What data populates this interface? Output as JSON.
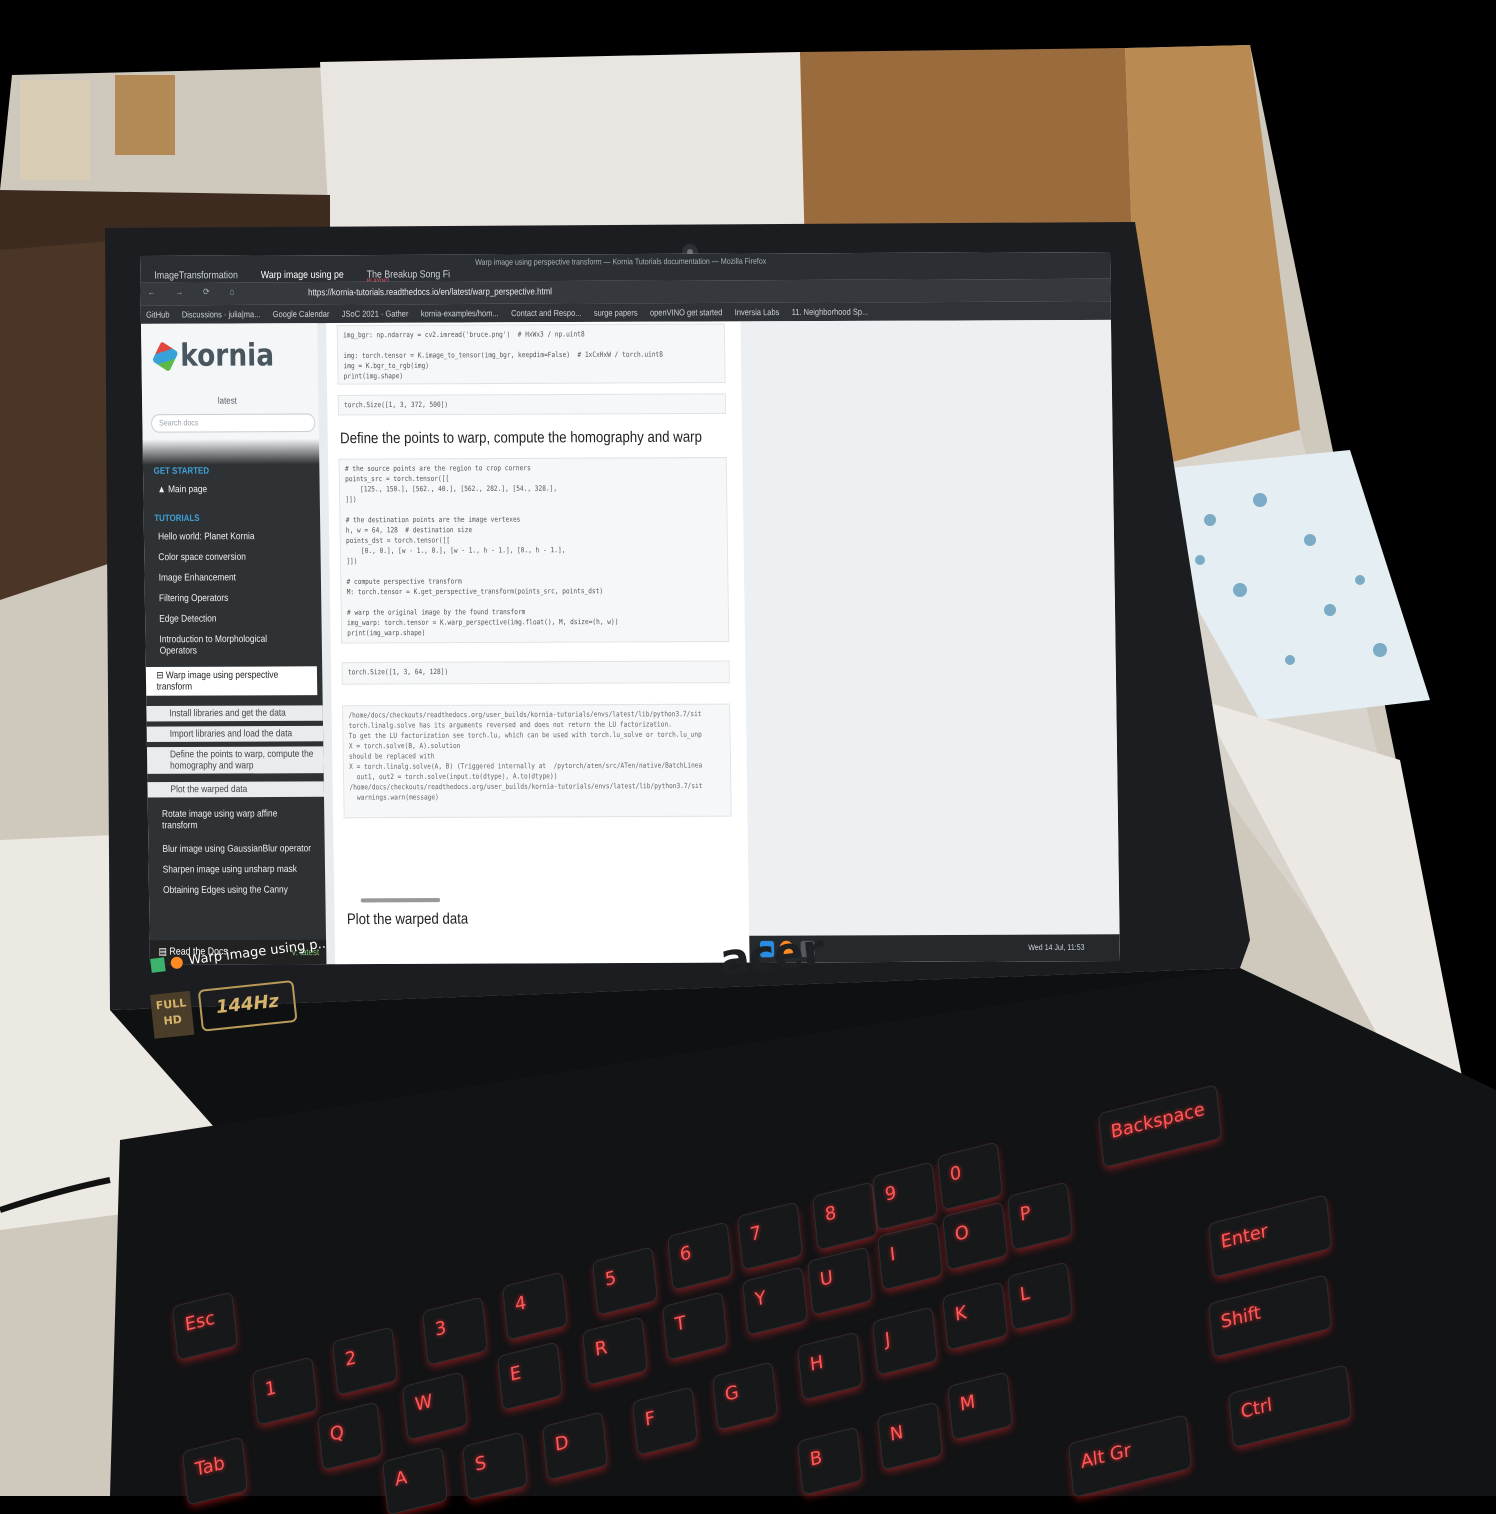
{
  "browser": {
    "window_title": "Warp image using perspective transform — Kornia Tutorials documentation — Mozilla Firefox",
    "tabs": [
      {
        "label": "ImageTransformation"
      },
      {
        "label": "Warp image using pe"
      },
      {
        "label": "The Breakup Song Fi",
        "sub": "PLAYING"
      }
    ],
    "url": "https://kornia-tutorials.readthedocs.io/en/latest/warp_perspective.html",
    "bookmarks": [
      "GitHub",
      "Discussions · julia|ma...",
      "Google Calendar",
      "JSoC 2021 · Gather",
      "kornia-examples/hom...",
      "Contact and Respo...",
      "surge papers",
      "openVINO get started",
      "Inversia Labs",
      "11. Neighborhood Sp..."
    ]
  },
  "sidebar": {
    "logo_text": "kornia",
    "version": "latest",
    "search_placeholder": "Search docs",
    "section_get_started": "GET STARTED",
    "main_page": "Main page",
    "section_tutorials": "TUTORIALS",
    "items": [
      "Hello world: Planet Kornia",
      "Color space conversion",
      "Image Enhancement",
      "Filtering Operators",
      "Edge Detection",
      "Introduction to Morphological Operators"
    ],
    "current": "Warp image using perspective transform",
    "subitems": [
      "Install libraries and get the data",
      "Import libraries and load the data",
      "Define the points to warp, compute the homography and warp",
      "Plot the warped data"
    ],
    "after_items": [
      "Rotate image using warp affine transform",
      "Blur image using GaussianBlur operator",
      "Sharpen image using unsharp mask",
      "Obtaining Edges using the Canny"
    ],
    "rtd_label": "Read the Docs",
    "rtd_version": "v: latest"
  },
  "content": {
    "code1": "img_bgr: np.ndarray = cv2.imread('bruce.png')  # HxWx3 / np.uint8\n\nimg: torch.tensor = K.image_to_tensor(img_bgr, keepdim=False)  # 1xCxHxW / torch.uint8\nimg = K.bgr_to_rgb(img)\nprint(img.shape)",
    "out1": "torch.Size([1, 3, 372, 500])",
    "heading1": "Define the points to warp, compute the homography and warp",
    "code2": "# the source points are the region to crop corners\npoints_src = torch.tensor([[\n    [125., 150.], [562., 40.], [562., 282.], [54., 328.],\n]])\n\n# the destination points are the image vertexes\nh, w = 64, 128  # destination size\npoints_dst = torch.tensor([[\n    [0., 0.], [w - 1., 0.], [w - 1., h - 1.], [0., h - 1.],\n]])\n\n# compute perspective transform\nM: torch.tensor = K.get_perspective_transform(points_src, points_dst)\n\n# warp the original image by the found transform\nimg_warp: torch.tensor = K.warp_perspective(img.float(), M, dsize=(h, w))\nprint(img_warp.shape)",
    "out2": "torch.Size([1, 3, 64, 128])",
    "warning": "/home/docs/checkouts/readthedocs.org/user_builds/kornia-tutorials/envs/latest/lib/python3.7/sit\ntorch.linalg.solve has its arguments reversed and does not return the LU factorization.\nTo get the LU factorization see torch.lu, which can be used with torch.lu_solve or torch.lu_unp\nX = torch.solve(B, A).solution\nshould be replaced with\nX = torch.linalg.solve(A, B) (Triggered internally at  /pytorch/aten/src/ATen/native/BatchLinea\n  out1, out2 = torch.solve(input.to(dtype), A.to(dtype))\n/home/docs/checkouts/readthedocs.org/user_builds/kornia-tutorials/envs/latest/lib/python3.7/sit\n  warnings.warn(message)",
    "heading2": "Plot the warped data"
  },
  "taskbar": {
    "clock": "Wed 14 Jul, 11:53",
    "app_title": "Warp image using p..."
  },
  "laptop": {
    "brand": "acer",
    "badge_full_hd": "FULL HD",
    "badge_hz": "144Hz",
    "keys": [
      "Esc",
      "Tab",
      "Q",
      "W",
      "E",
      "R",
      "T",
      "Y",
      "U",
      "I",
      "O",
      "P",
      "A",
      "S",
      "D",
      "F",
      "G",
      "H",
      "J",
      "K",
      "L",
      "B",
      "N",
      "M",
      "1",
      "2",
      "3",
      "4",
      "5",
      "6",
      "7",
      "8",
      "9",
      "0",
      "Backspace",
      "Enter",
      "Shift",
      "Ctrl",
      "Alt Gr"
    ]
  },
  "colors": {
    "keyboard_backlight": "#ff3b3b",
    "kornia_blue": "#3fa0d8",
    "sidebar_dark": "#2f3235"
  }
}
